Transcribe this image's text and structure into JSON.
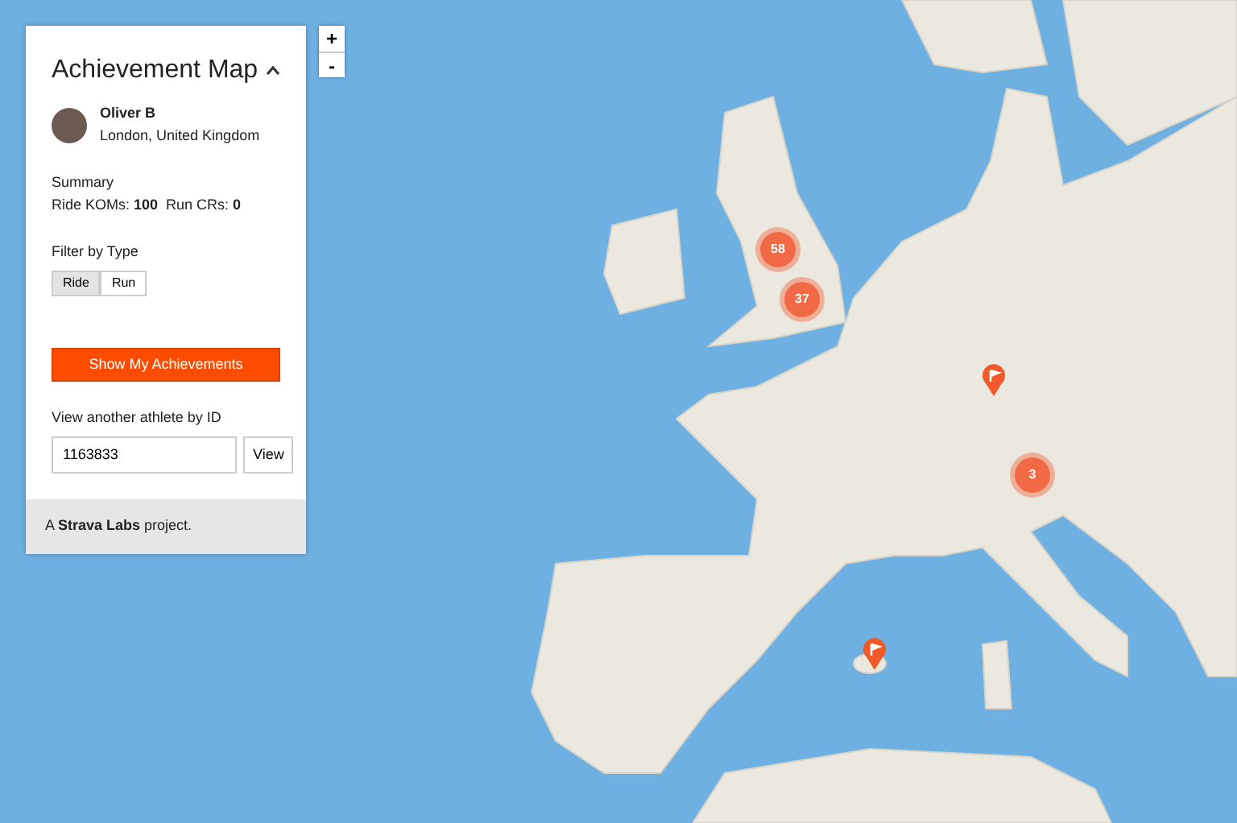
{
  "panel": {
    "title": "Achievement Map",
    "collapsed": false,
    "athlete": {
      "name": "Oliver B",
      "location": "London, United Kingdom"
    },
    "summary": {
      "heading": "Summary",
      "stats": [
        {
          "label": "Ride KOMs:",
          "value": "100"
        },
        {
          "label": "Run CRs:",
          "value": "0"
        }
      ]
    },
    "filter": {
      "heading": "Filter by Type",
      "options": [
        {
          "label": "Ride",
          "selected": true
        },
        {
          "label": "Run",
          "selected": false
        }
      ]
    },
    "primary_button": "Show My Achievements",
    "lookup": {
      "label": "View another athlete by ID",
      "value": "1163833",
      "button": "View"
    },
    "footer": "A **Strava Labs** project."
  },
  "zoom": [
    "+",
    "-"
  ],
  "markers": [
    {
      "kind": "cluster",
      "count": "58"
    },
    {
      "kind": "cluster",
      "count": "37"
    },
    {
      "kind": "flag"
    },
    {
      "kind": "cluster",
      "count": "3"
    },
    {
      "kind": "flag"
    }
  ]
}
